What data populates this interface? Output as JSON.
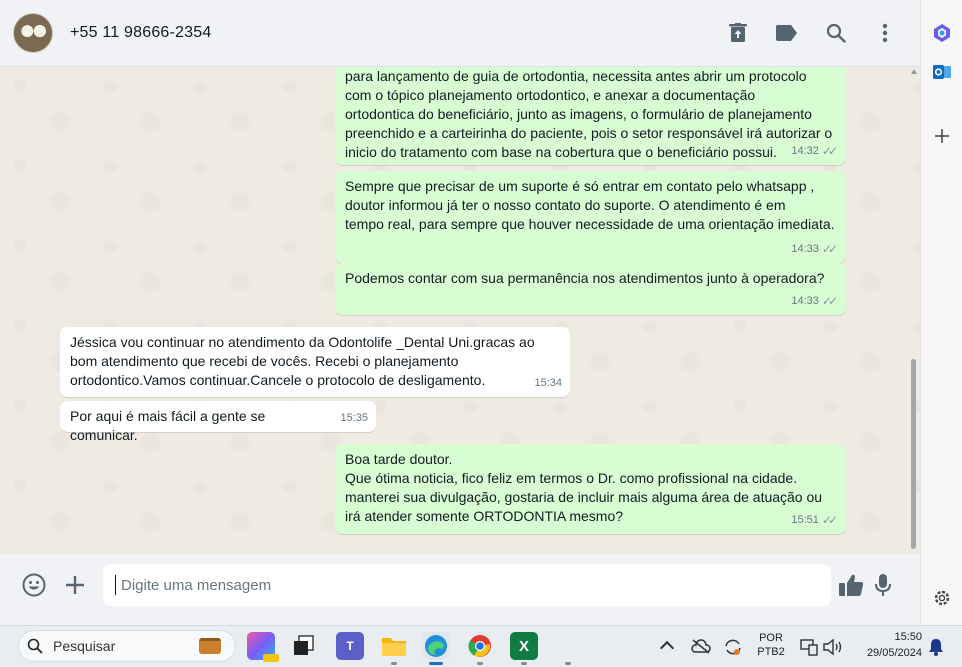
{
  "header": {
    "contact_name": "+55 11 98666-2354",
    "actions": [
      "archive-icon",
      "label-icon",
      "search-icon",
      "more-options-icon"
    ]
  },
  "messages": [
    {
      "direction": "out",
      "text": "para lançamento de guia de ortodontia, necessita antes abrir um protocolo\ncom o tópico planejamento ortodontico, e anexar a documentação\nortodontica do beneficiário, junto as imagens, o formulário de planejamento\npreenchido e a carteirinha do paciente, pois o setor responsável irá autorizar o\ninicio do tratamento com base na cobertura que o beneficiário possui.",
      "time": "14:32",
      "read": true
    },
    {
      "direction": "out",
      "text": "Sempre que precisar de um suporte é só entrar em contato pelo whatsapp ,\ndoutor informou já ter o nosso contato do suporte. O atendimento é em\ntempo real, para sempre que houver necessidade de uma orientação imediata.",
      "time": "14:33",
      "read": true
    },
    {
      "direction": "out",
      "text": "Podemos contar com sua permanência nos atendimentos junto à operadora?",
      "time": "14:33",
      "read": true
    },
    {
      "direction": "in",
      "text": "Jéssica vou continuar no atendimento da Odontolife _Dental Uni.gracas ao\nbom atendimento que recebi de vocês. Recebi o planejamento\nortodontico.Vamos continuar.Cancele o protocolo de desligamento.",
      "time": "15:34"
    },
    {
      "direction": "in",
      "text": "Por aqui é mais fácil a gente se comunicar.",
      "time": "15:35"
    },
    {
      "direction": "out",
      "text": "Boa tarde doutor.\nQue ótima noticia, fico feliz em termos o Dr. como profissional na cidade.\nmanterei sua divulgação, gostaria de incluir mais alguma área de atuação ou\nirá atender somente ORTODONTIA mesmo?",
      "time": "15:51",
      "read": true
    }
  ],
  "composer": {
    "placeholder": "Digite uma mensagem",
    "icons": [
      "emoji-icon",
      "attach-plus-icon",
      "thumbs-up-icon",
      "microphone-icon"
    ]
  },
  "taskbar": {
    "search_label": "Pesquisar",
    "language": "POR",
    "keyboard": "PTB2",
    "time": "15:50",
    "date": "29/05/2024",
    "excel_letter": "X"
  },
  "colors": {
    "outgoing_bubble": "#d9fdd3",
    "incoming_bubble": "#ffffff",
    "chat_background": "#efeae2",
    "header_background": "#f0f2f5"
  }
}
